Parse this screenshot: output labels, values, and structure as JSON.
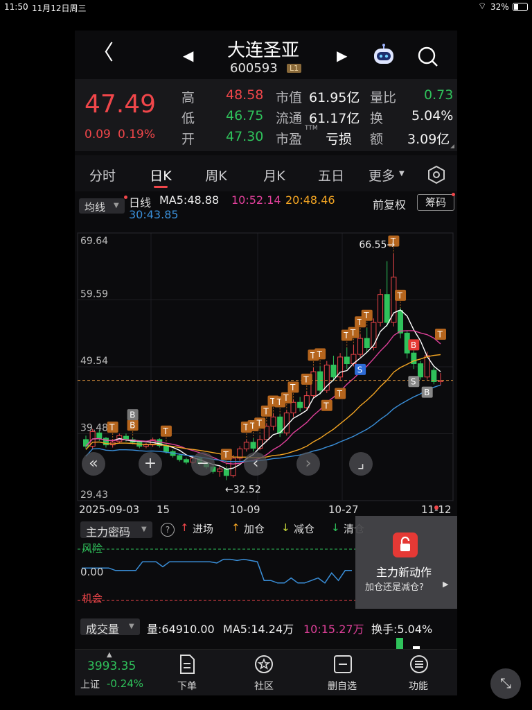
{
  "status_bar": {
    "time": "11:50",
    "date": "11月12日周三",
    "battery": "32%"
  },
  "header": {
    "stock_name": "大连圣亚",
    "stock_code": "600593",
    "level_badge": "L1"
  },
  "quote": {
    "price": "47.49",
    "change": "0.09",
    "change_pct": "0.19%",
    "high_label": "高",
    "high": "48.58",
    "low_label": "低",
    "low": "46.75",
    "open_label": "开",
    "open": "47.30",
    "mktcap_label": "市值",
    "mktcap": "61.95亿",
    "float_label": "流通",
    "float": "61.17亿",
    "pe_label": "市盈",
    "pe_sup": "TTM",
    "pe": "亏损",
    "volratio_label": "量比",
    "volratio": "0.73",
    "turnover_label": "换",
    "turnover": "5.04%",
    "amount_label": "额",
    "amount": "3.09亿"
  },
  "tabs": [
    "分时",
    "日K",
    "周K",
    "月K",
    "五日",
    "更多"
  ],
  "active_tab": "日K",
  "chart_header": {
    "ma_select": "均线",
    "line_type": "日线",
    "ma5": "MA5:48.88",
    "ma10": "10:52.14",
    "ma20": "20:48.46",
    "ma30": "30:43.85",
    "adjust": "前复权",
    "chips": "筹码"
  },
  "colors": {
    "up": "#f0464a",
    "down": "#2fc25b",
    "ma5": "#ffffff",
    "ma10": "#e0409a",
    "ma20": "#f5a623",
    "ma30": "#3a8fd9",
    "tag": "#b5651d"
  },
  "chart_data": {
    "type": "candlestick",
    "y_ticks": [
      "69.64",
      "59.59",
      "49.54",
      "39.48",
      "29.43"
    ],
    "ylim": [
      29.43,
      69.64
    ],
    "x_labels": [
      "2025-09-03",
      "15",
      "10-09",
      "10-27",
      "11-12"
    ],
    "max_annotation": "66.55→",
    "min_annotation": "←32.52",
    "last_price_line": 47.49,
    "candles": [
      [
        38.6,
        37.6,
        39.2,
        37.2
      ],
      [
        37.6,
        39.8,
        40.2,
        37.2
      ],
      [
        39.6,
        38.8,
        40.0,
        38.4
      ],
      [
        38.8,
        37.8,
        39.0,
        37.4
      ],
      [
        37.8,
        38.2,
        38.6,
        37.4
      ],
      [
        38.3,
        39.2,
        39.5,
        38.0
      ],
      [
        39.1,
        38.6,
        39.5,
        38.3
      ],
      [
        38.6,
        38.2,
        38.9,
        37.9
      ],
      [
        38.2,
        37.6,
        38.5,
        37.3
      ],
      [
        37.6,
        37.8,
        38.1,
        37.3
      ],
      [
        37.8,
        38.6,
        38.9,
        37.5
      ],
      [
        38.6,
        37.7,
        38.8,
        37.4
      ],
      [
        37.7,
        36.8,
        38.0,
        36.5
      ],
      [
        36.8,
        36.2,
        37.1,
        35.9
      ],
      [
        36.2,
        35.6,
        36.5,
        35.3
      ],
      [
        35.6,
        35.2,
        35.9,
        34.9
      ],
      [
        35.2,
        35.8,
        36.1,
        34.9
      ],
      [
        35.8,
        35.0,
        36.0,
        34.7
      ],
      [
        35.0,
        34.5,
        35.3,
        34.2
      ],
      [
        34.5,
        33.8,
        34.8,
        33.5
      ],
      [
        33.8,
        34.2,
        34.6,
        33.0
      ],
      [
        34.2,
        33.2,
        34.5,
        32.5
      ],
      [
        33.2,
        35.8,
        36.3,
        32.9
      ],
      [
        35.8,
        37.2,
        37.6,
        35.4
      ],
      [
        37.2,
        38.2,
        38.6,
        36.8
      ],
      [
        38.2,
        37.3,
        38.8,
        36.8
      ],
      [
        37.3,
        38.6,
        39.2,
        37.0
      ],
      [
        38.6,
        40.6,
        41.0,
        38.2
      ],
      [
        40.6,
        42.0,
        42.5,
        40.0
      ],
      [
        42.0,
        39.6,
        42.4,
        39.0
      ],
      [
        39.6,
        42.6,
        43.0,
        39.2
      ],
      [
        42.6,
        44.2,
        44.6,
        42.0
      ],
      [
        44.2,
        43.4,
        45.0,
        42.8
      ],
      [
        43.4,
        45.2,
        45.8,
        43.0
      ],
      [
        45.2,
        48.8,
        49.4,
        44.8
      ],
      [
        48.8,
        46.0,
        49.6,
        45.4
      ],
      [
        46.0,
        49.8,
        50.4,
        45.6
      ],
      [
        49.8,
        48.0,
        51.2,
        47.4
      ],
      [
        48.0,
        51.0,
        51.6,
        47.4
      ],
      [
        51.0,
        50.0,
        52.4,
        49.2
      ],
      [
        50.0,
        51.4,
        52.8,
        49.6
      ],
      [
        51.4,
        53.8,
        54.4,
        51.0
      ],
      [
        53.8,
        52.4,
        55.4,
        51.8
      ],
      [
        52.4,
        56.2,
        56.8,
        52.0
      ],
      [
        56.2,
        60.4,
        61.2,
        55.6
      ],
      [
        60.4,
        56.2,
        65.4,
        55.6
      ],
      [
        56.2,
        63.0,
        66.55,
        55.6
      ],
      [
        58.0,
        54.6,
        58.4,
        53.8
      ],
      [
        54.6,
        51.6,
        55.0,
        50.8
      ],
      [
        51.6,
        50.0,
        52.0,
        49.2
      ],
      [
        50.0,
        48.0,
        50.4,
        47.6
      ],
      [
        48.0,
        51.2,
        51.8,
        47.6
      ],
      [
        49.0,
        47.3,
        49.4,
        46.9
      ],
      [
        47.3,
        47.49,
        48.58,
        46.75
      ]
    ],
    "signal_tags": [
      "T",
      "B",
      "S"
    ]
  },
  "nav_buttons": [
    "«",
    "+",
    "−",
    "‹",
    "›",
    "⌟"
  ],
  "indicator": {
    "select": "主力密码",
    "enter": "进场",
    "add": "加仓",
    "reduce": "减仓",
    "clear": "清仓",
    "risk_label": "风险",
    "zero_label": "0.00",
    "chance_label": "机会",
    "promo_title": "主力新动作",
    "promo_sub": "加仓还是减仓?",
    "line": [
      0.3,
      0.3,
      0.3,
      0.3,
      0.3,
      0.2,
      0.2,
      0.2,
      0.2,
      0.55,
      0.55,
      0.55,
      0.35,
      0.55,
      0.55,
      0.55,
      0.55,
      0.55,
      0.55,
      0.55,
      0.5,
      0.65,
      0.65,
      0.6,
      0.65,
      0.6,
      0.55,
      -0.2,
      -0.2,
      -0.3,
      -0.3,
      -0.1,
      -0.3,
      -0.3,
      -0.2,
      -0.1,
      -0.3,
      0.1,
      -0.2,
      0.2,
      0.2
    ]
  },
  "volume": {
    "select": "成交量",
    "vol": "量:64910.00",
    "ma5": "MA5:14.24万",
    "ma10": "10:15.27万",
    "turnover": "换手:5.04%"
  },
  "bottom_bar": {
    "index_value": "3993.35",
    "index_name": "上证",
    "index_change": "-0.24%",
    "items": [
      "下单",
      "社区",
      "删自选",
      "功能"
    ]
  }
}
